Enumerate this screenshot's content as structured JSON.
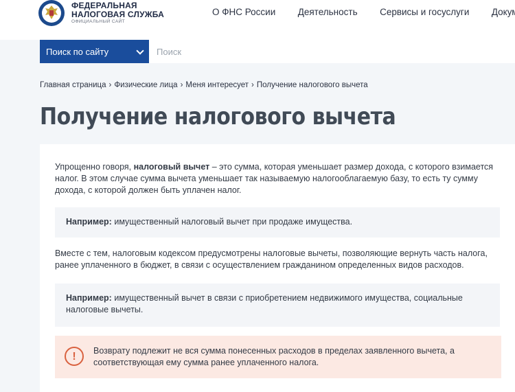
{
  "header": {
    "logo_line1": "ФЕДЕРАЛЬНАЯ",
    "logo_line2": "НАЛОГОВАЯ СЛУЖБА",
    "logo_line3": "ОФИЦИАЛЬНЫЙ САЙТ",
    "nav": [
      "О ФНС России",
      "Деятельность",
      "Сервисы и госуслуги",
      "Документы"
    ]
  },
  "search": {
    "scope_label": "Поиск по сайту",
    "placeholder": "Поиск",
    "value": ""
  },
  "breadcrumb": [
    "Главная страница",
    "Физические лица",
    "Меня интересует",
    "Получение налогового вычета"
  ],
  "page": {
    "title": "Получение налогового вычета"
  },
  "content": {
    "p1_before": "Упрощенно говоря, ",
    "p1_bold": "налоговый вычет",
    "p1_after": " – это сумма, которая уменьшает размер дохода, с которого взимается налог. В этом случае сумма вычета уменьшает так называемую налогооблагаемую базу, то есть ту сумму дохода, с которой должен быть уплачен налог.",
    "example1_label": "Например:",
    "example1_text": " имущественный налоговый вычет при продаже имущества.",
    "p2": "Вместе с тем, налоговым кодексом предусмотрены налоговые вычеты, позволяющие вернуть часть налога, ранее уплаченного в бюджет, в связи с осуществлением гражданином определенных видов расходов.",
    "example2_label": "Например:",
    "example2_text": " имущественный вычет в связи с приобретением недвижимого имущества, социальные налоговые вычеты.",
    "notice_icon": "!",
    "notice_text": "Возврату подлежит не вся сумма понесенных расходов в пределах заявленного вычета, а соответствующая ему сумма ранее уплаченного налога."
  },
  "icons": {
    "logo": "fns-emblem-icon",
    "dropdown": "chevron-down-icon",
    "notice": "exclamation-circle-icon"
  },
  "colors": {
    "brand_blue": "#1a4d9c",
    "notice_bg": "#fce9e3",
    "notice_accent": "#d9613f"
  }
}
